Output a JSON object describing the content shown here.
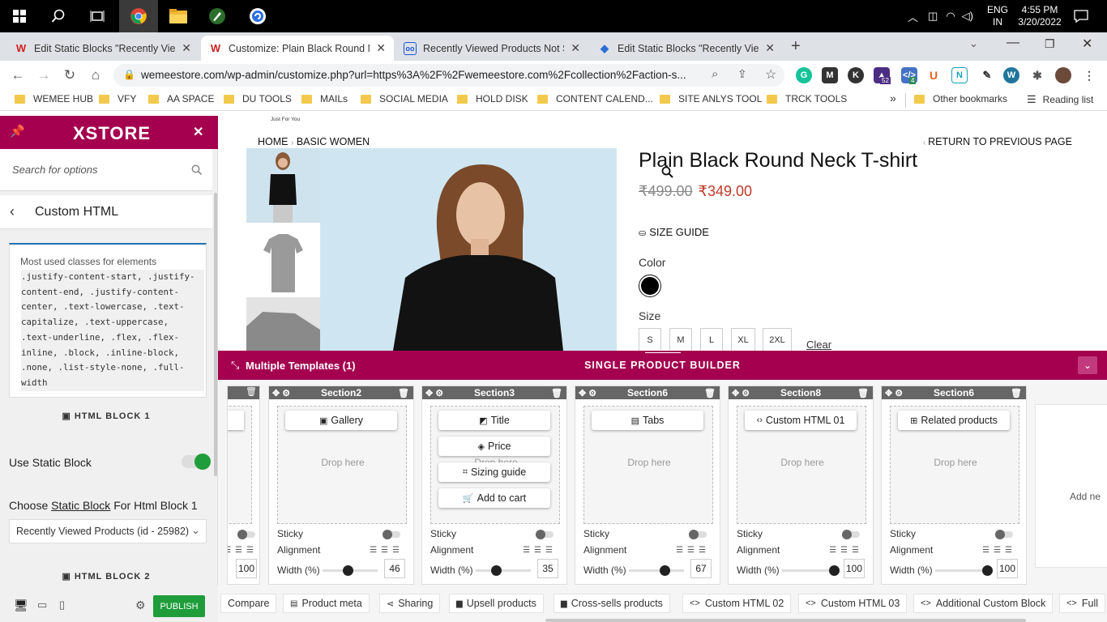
{
  "taskbar": {
    "lang1": "ENG",
    "lang2": "IN",
    "time": "4:55 PM",
    "date": "3/20/2022"
  },
  "tabs": [
    {
      "title": "Edit Static Blocks \"Recently Viewed",
      "favicon": "W",
      "color": "#d12020"
    },
    {
      "title": "Customize: Plain Black Round Ne",
      "favicon": "W",
      "color": "#d12020"
    },
    {
      "title": "Recently Viewed Products Not Sh",
      "favicon": "oo",
      "color": "#1a56d6"
    },
    {
      "title": "Edit Static Blocks \"Recently Viewe",
      "favicon": "◆",
      "color": "#2b6fd6"
    }
  ],
  "address": {
    "url": "wemeestore.com/wp-admin/customize.php?url=https%3A%2F%2Fwemeestore.com%2Fcollection%2Faction-s..."
  },
  "extensions": {
    "badge1": "52",
    "badge2": "4"
  },
  "bookmarks": [
    "WEMEE HUB",
    "VFY",
    "AA SPACE",
    "DU TOOLS",
    "MAILs",
    "SOCIAL MEDIA",
    "HOLD DISK",
    "CONTENT CALEND...",
    "SITE ANLYS TOOL",
    "TRCK TOOLS"
  ],
  "bookmarks_more": "»",
  "other_bookmarks": "Other bookmarks",
  "reading_list": "Reading list",
  "sidebar": {
    "brand": "XSTORE",
    "search_placeholder": "Search for options",
    "section_title": "Custom HTML",
    "classes_label": "Most used classes for elements",
    "classes": ".justify-content-start, .justify-content-end, .justify-content-center, .text-lowercase, .text-capitalize, .text-uppercase, .text-underline, .flex, .flex-inline, .block, .inline-block, .none, .list-style-none, .full-width",
    "html_block_1": "HTML BLOCK 1",
    "use_static_block": "Use Static Block",
    "choose_prefix": "Choose",
    "choose_link": "Static Block",
    "choose_suffix": "For Html Block 1",
    "select_value": "Recently Viewed Products (id - 25982)",
    "html_block_2": "HTML BLOCK 2",
    "publish": "PUBLISH"
  },
  "page": {
    "tagline": "Just For You",
    "breadcrumb_home": "HOME",
    "breadcrumb_sep": "›",
    "breadcrumb_cat": "BASIC WOMEN",
    "return": "RETURN TO PREVIOUS PAGE",
    "product_title": "Plain Black Round Neck T-shirt",
    "old_price": "₹499.00",
    "new_price": "₹349.00",
    "size_guide": "SIZE GUIDE",
    "color_label": "Color",
    "size_label": "Size",
    "sizes": [
      "S",
      "M",
      "L",
      "XL",
      "2XL"
    ],
    "clear": "Clear"
  },
  "builder": {
    "templates": "Multiple Templates (1)",
    "title": "SINGLE PRODUCT BUILDER",
    "drop_here": "Drop here",
    "sticky": "Sticky",
    "alignment": "Alignment",
    "width": "Width (%)",
    "first_width": "100",
    "columns": [
      {
        "name": "Section2",
        "chips": [
          "Gallery"
        ],
        "width": "46"
      },
      {
        "name": "Section3",
        "chips": [
          "Title",
          "Price",
          "Sizing guide",
          "Add to cart"
        ],
        "width": "35"
      },
      {
        "name": "Section6",
        "chips": [
          "Tabs"
        ],
        "width": "67"
      },
      {
        "name": "Section8",
        "chips": [
          "Custom HTML 01"
        ],
        "width": "100"
      },
      {
        "name": "Section6",
        "chips": [
          "Related products"
        ],
        "width": "100"
      }
    ],
    "add_new": "Add ne",
    "bottom": [
      "Compare",
      "Product meta",
      "Sharing",
      "Upsell products",
      "Cross-sells products",
      "Custom HTML 02",
      "Custom HTML 03",
      "Additional Custom Block",
      "Full"
    ]
  }
}
